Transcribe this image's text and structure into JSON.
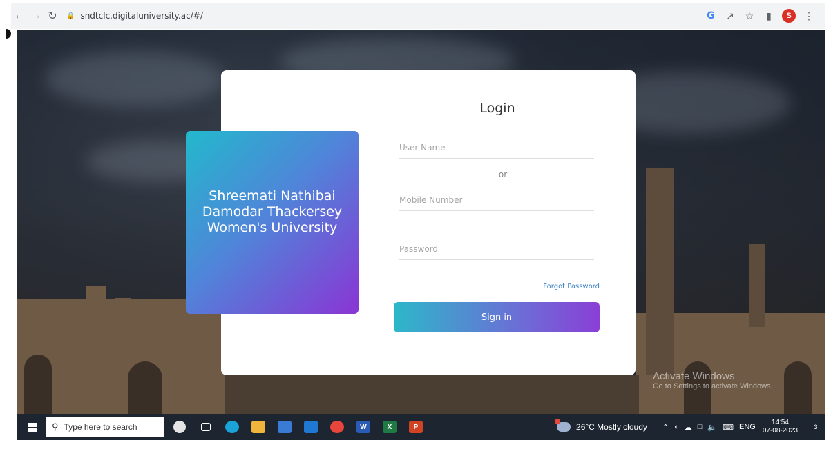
{
  "browser": {
    "url": "sndtclc.digitaluniversity.ac/#/",
    "profile_initial": "S",
    "icons": [
      "back-icon",
      "forward-icon",
      "reload-icon",
      "lock-icon",
      "google-icon",
      "share-icon",
      "star-icon",
      "sidepanel-icon",
      "menu-icon"
    ]
  },
  "login": {
    "title": "Login",
    "username_placeholder": "User Name",
    "or_label": "or",
    "mobile_placeholder": "Mobile Number",
    "password_placeholder": "Password",
    "forgot_label": "Forgot Password",
    "signin_label": "Sign in"
  },
  "university": {
    "name": "Shreemati Nathibai Damodar Thackersey Women's University"
  },
  "watermark": {
    "line1": "Activate Windows",
    "line2": "Go to Settings to activate Windows."
  },
  "taskbar": {
    "search_placeholder": "Type here to search",
    "weather": "26°C  Mostly cloudy",
    "language": "ENG",
    "time": "14:54",
    "date": "07-08-2023",
    "notifications": "3",
    "colors": {
      "taskbar_bg": "#1c2530",
      "gradient_start": "#2db7c9",
      "gradient_end": "#8a3fd6"
    }
  }
}
